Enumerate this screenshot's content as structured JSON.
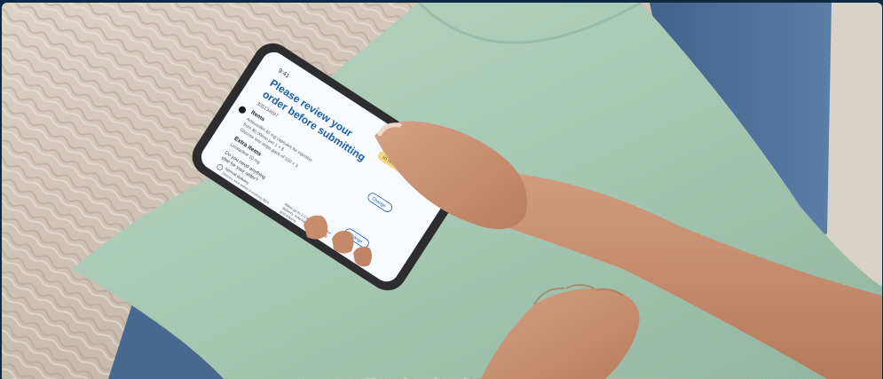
{
  "image": {
    "alt": "",
    "colors": {
      "frame": "#0f2942",
      "blanket": "#cfc4b6",
      "pillow": "#a6c7b2",
      "jeans": "#4b6f98",
      "skin": "#c99171",
      "phone_body": "#2d2d2f",
      "screen": "#f7fbff",
      "screen_title": "#1c5ea8",
      "badge": "#f7d786"
    }
  },
  "phone": {
    "status_time": "9:41",
    "screen_title_line1": "Please review your",
    "screen_title_line2": "order before submitting",
    "badge_label": "In review",
    "order_number": "305134697",
    "section_items": "Items",
    "item_line1": "Amoxicillin 40 mg capsules for injection",
    "item_line2": "from $0.00/mo per 1 × 8",
    "item_line3": "Glucose test strips pack of 100 × 3",
    "section_extras": "Extra items",
    "extras_line1": "Loratadine 10 mg",
    "question_line1": "Do you need anything",
    "question_line2": "else for your order?",
    "delivery_line1": "Normal delivery",
    "delivery_line2": "Delivery time within 3 working days",
    "notes_line1": "Allow up to 2-3 business days for",
    "notes_line2": "delivery. Information on shipping",
    "notes_line3": "and returns.",
    "change_label": "Change",
    "edit_label": "Change"
  }
}
